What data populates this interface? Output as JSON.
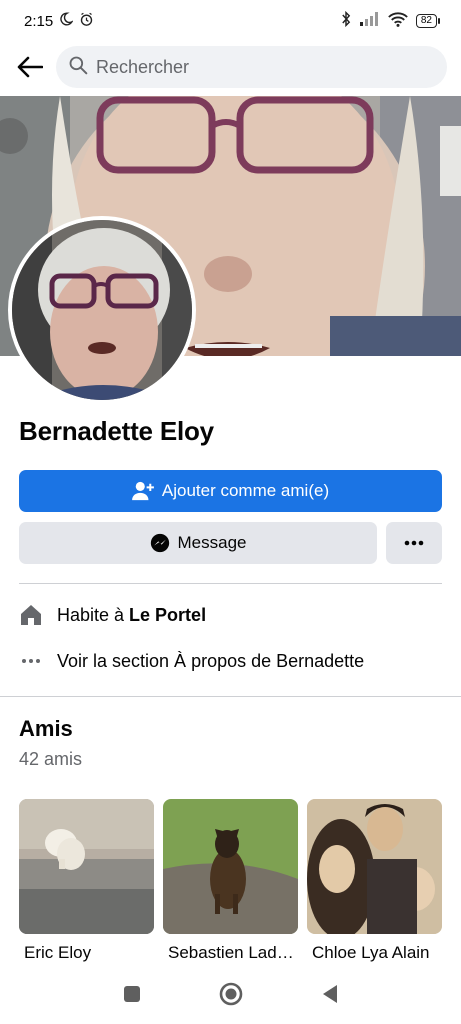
{
  "status": {
    "time": "2:15",
    "battery": "82"
  },
  "search": {
    "placeholder": "Rechercher"
  },
  "profile": {
    "name": "Bernadette Eloy"
  },
  "actions": {
    "add_friend": "Ajouter comme ami(e)",
    "message": "Message"
  },
  "info": {
    "lives_prefix": "Habite à ",
    "lives_city": "Le Portel",
    "about": "Voir la section À propos de Bernadette"
  },
  "friends": {
    "title": "Amis",
    "count": "42 amis",
    "items": [
      {
        "name": "Eric Eloy"
      },
      {
        "name": "Sebastien Lad…"
      },
      {
        "name": "Chloe Lya Alain"
      }
    ]
  },
  "colors": {
    "accent": "#1b74e4",
    "secondary_btn": "#e4e6eb",
    "muted_text": "#65676b"
  }
}
